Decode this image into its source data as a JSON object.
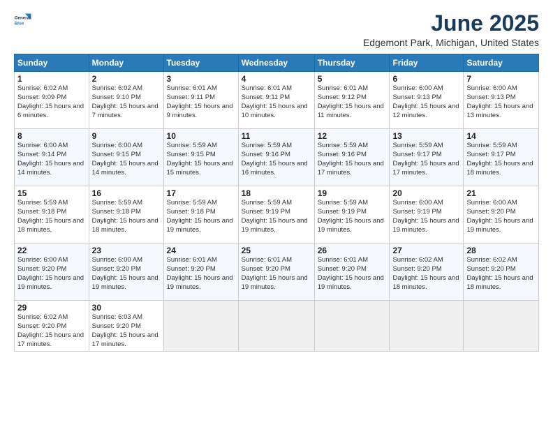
{
  "logo": {
    "line1": "General",
    "line2": "Blue"
  },
  "title": "June 2025",
  "location": "Edgemont Park, Michigan, United States",
  "headers": [
    "Sunday",
    "Monday",
    "Tuesday",
    "Wednesday",
    "Thursday",
    "Friday",
    "Saturday"
  ],
  "weeks": [
    [
      {
        "day": "1",
        "sunrise": "6:02 AM",
        "sunset": "9:09 PM",
        "daylight": "15 hours and 6 minutes."
      },
      {
        "day": "2",
        "sunrise": "6:02 AM",
        "sunset": "9:10 PM",
        "daylight": "15 hours and 7 minutes."
      },
      {
        "day": "3",
        "sunrise": "6:01 AM",
        "sunset": "9:11 PM",
        "daylight": "15 hours and 9 minutes."
      },
      {
        "day": "4",
        "sunrise": "6:01 AM",
        "sunset": "9:11 PM",
        "daylight": "15 hours and 10 minutes."
      },
      {
        "day": "5",
        "sunrise": "6:01 AM",
        "sunset": "9:12 PM",
        "daylight": "15 hours and 11 minutes."
      },
      {
        "day": "6",
        "sunrise": "6:00 AM",
        "sunset": "9:13 PM",
        "daylight": "15 hours and 12 minutes."
      },
      {
        "day": "7",
        "sunrise": "6:00 AM",
        "sunset": "9:13 PM",
        "daylight": "15 hours and 13 minutes."
      }
    ],
    [
      {
        "day": "8",
        "sunrise": "6:00 AM",
        "sunset": "9:14 PM",
        "daylight": "15 hours and 14 minutes."
      },
      {
        "day": "9",
        "sunrise": "6:00 AM",
        "sunset": "9:15 PM",
        "daylight": "15 hours and 14 minutes."
      },
      {
        "day": "10",
        "sunrise": "5:59 AM",
        "sunset": "9:15 PM",
        "daylight": "15 hours and 15 minutes."
      },
      {
        "day": "11",
        "sunrise": "5:59 AM",
        "sunset": "9:16 PM",
        "daylight": "15 hours and 16 minutes."
      },
      {
        "day": "12",
        "sunrise": "5:59 AM",
        "sunset": "9:16 PM",
        "daylight": "15 hours and 17 minutes."
      },
      {
        "day": "13",
        "sunrise": "5:59 AM",
        "sunset": "9:17 PM",
        "daylight": "15 hours and 17 minutes."
      },
      {
        "day": "14",
        "sunrise": "5:59 AM",
        "sunset": "9:17 PM",
        "daylight": "15 hours and 18 minutes."
      }
    ],
    [
      {
        "day": "15",
        "sunrise": "5:59 AM",
        "sunset": "9:18 PM",
        "daylight": "15 hours and 18 minutes."
      },
      {
        "day": "16",
        "sunrise": "5:59 AM",
        "sunset": "9:18 PM",
        "daylight": "15 hours and 18 minutes."
      },
      {
        "day": "17",
        "sunrise": "5:59 AM",
        "sunset": "9:18 PM",
        "daylight": "15 hours and 19 minutes."
      },
      {
        "day": "18",
        "sunrise": "5:59 AM",
        "sunset": "9:19 PM",
        "daylight": "15 hours and 19 minutes."
      },
      {
        "day": "19",
        "sunrise": "5:59 AM",
        "sunset": "9:19 PM",
        "daylight": "15 hours and 19 minutes."
      },
      {
        "day": "20",
        "sunrise": "6:00 AM",
        "sunset": "9:19 PM",
        "daylight": "15 hours and 19 minutes."
      },
      {
        "day": "21",
        "sunrise": "6:00 AM",
        "sunset": "9:20 PM",
        "daylight": "15 hours and 19 minutes."
      }
    ],
    [
      {
        "day": "22",
        "sunrise": "6:00 AM",
        "sunset": "9:20 PM",
        "daylight": "15 hours and 19 minutes."
      },
      {
        "day": "23",
        "sunrise": "6:00 AM",
        "sunset": "9:20 PM",
        "daylight": "15 hours and 19 minutes."
      },
      {
        "day": "24",
        "sunrise": "6:01 AM",
        "sunset": "9:20 PM",
        "daylight": "15 hours and 19 minutes."
      },
      {
        "day": "25",
        "sunrise": "6:01 AM",
        "sunset": "9:20 PM",
        "daylight": "15 hours and 19 minutes."
      },
      {
        "day": "26",
        "sunrise": "6:01 AM",
        "sunset": "9:20 PM",
        "daylight": "15 hours and 19 minutes."
      },
      {
        "day": "27",
        "sunrise": "6:02 AM",
        "sunset": "9:20 PM",
        "daylight": "15 hours and 18 minutes."
      },
      {
        "day": "28",
        "sunrise": "6:02 AM",
        "sunset": "9:20 PM",
        "daylight": "15 hours and 18 minutes."
      }
    ],
    [
      {
        "day": "29",
        "sunrise": "6:02 AM",
        "sunset": "9:20 PM",
        "daylight": "15 hours and 17 minutes."
      },
      {
        "day": "30",
        "sunrise": "6:03 AM",
        "sunset": "9:20 PM",
        "daylight": "15 hours and 17 minutes."
      },
      null,
      null,
      null,
      null,
      null
    ]
  ]
}
